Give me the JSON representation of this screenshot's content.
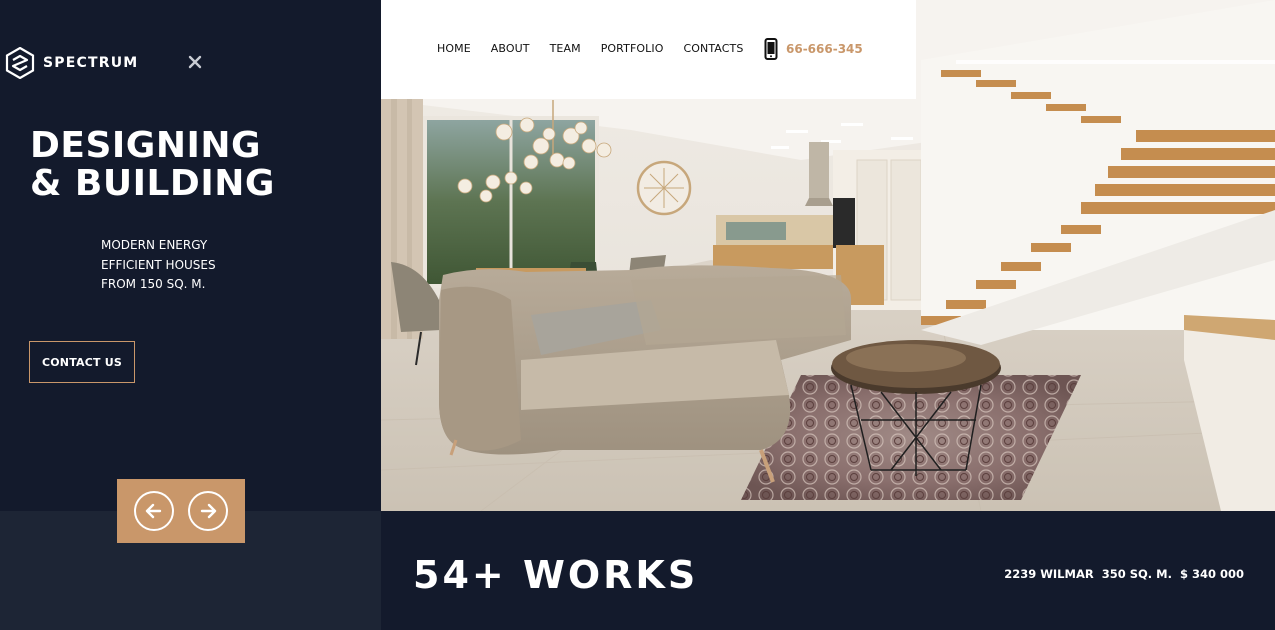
{
  "brand": {
    "name": "SPECTRUM"
  },
  "sidebar": {
    "headline_line1": "DESIGNING",
    "headline_line2": "& BUILDING",
    "subtext_line1": "MODERN ENERGY",
    "subtext_line2": "EFFICIENT HOUSES",
    "subtext_line3": "FROM 150 SQ. M.",
    "contact_button": "CONTACT US",
    "close_icon": "close-icon"
  },
  "nav": {
    "items": [
      {
        "label": "HOME"
      },
      {
        "label": "ABOUT"
      },
      {
        "label": "TEAM"
      },
      {
        "label": "PORTFOLIO"
      },
      {
        "label": "CONTACTS"
      }
    ],
    "phone": "66-666-345"
  },
  "slider": {
    "prev_icon": "arrow-left-icon",
    "next_icon": "arrow-right-icon"
  },
  "stats": {
    "works": "54+ WORKS",
    "listing": "2239 WILMAR  350 SQ. M.  $ 340 000"
  },
  "colors": {
    "dark_navy": "#131a2c",
    "accent": "#c9976a",
    "panel": "#1d2535"
  }
}
